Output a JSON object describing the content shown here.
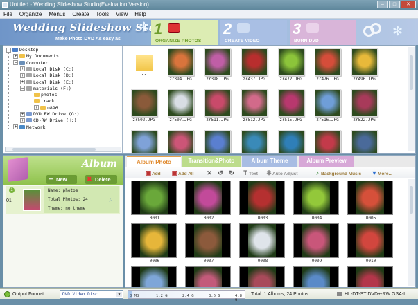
{
  "window": {
    "title": "Untitled - Wedding Slideshow Studio(Evaluation Version)"
  },
  "menu": [
    "File",
    "Organize",
    "Menus",
    "Create",
    "Tools",
    "View",
    "Help"
  ],
  "banner": {
    "logo": "Wedding Slideshow Studio",
    "slogan": "Make Photo DVD As easy as",
    "steps": [
      {
        "num": "1",
        "label": "ORGANIZE PHOTOS"
      },
      {
        "num": "2",
        "label": "CREATE VIDEO"
      },
      {
        "num": "3",
        "label": "BURN DVD"
      }
    ]
  },
  "tree": {
    "items": [
      {
        "label": "Desktop",
        "icon": "desktop-icon",
        "pm": "−"
      },
      {
        "label": "My Documents",
        "icon": "folder-icon",
        "pm": "+"
      },
      {
        "label": "Computer",
        "icon": "computer-icon",
        "pm": "−"
      },
      {
        "label": "Local Disk (C:)",
        "icon": "drive-icon",
        "pm": "+"
      },
      {
        "label": "Local Disk (D:)",
        "icon": "drive-icon",
        "pm": "+"
      },
      {
        "label": "Local Disk (E:)",
        "icon": "drive-icon",
        "pm": "+"
      },
      {
        "label": "materials (F:)",
        "icon": "drive-icon",
        "pm": "−"
      },
      {
        "label": "photos",
        "icon": "folder-icon",
        "pm": ""
      },
      {
        "label": "track",
        "icon": "folder-icon",
        "pm": ""
      },
      {
        "label": "u896",
        "icon": "folder-icon",
        "pm": "+"
      },
      {
        "label": "DVD RW Drive (G:)",
        "icon": "dvd-icon",
        "pm": "+"
      },
      {
        "label": "CD-RW Drive (H:)",
        "icon": "cd-icon",
        "pm": "+"
      },
      {
        "label": "Network",
        "icon": "network-icon",
        "pm": "+"
      }
    ]
  },
  "browser": {
    "files": [
      {
        "name": "..",
        "color": "#f2c64a",
        "folder": true
      },
      {
        "name": "zr394.JPG",
        "color": "#d9743c"
      },
      {
        "name": "zr398.JPG",
        "color": "#c05ea6"
      },
      {
        "name": "zr437.JPG",
        "color": "#b82e2e"
      },
      {
        "name": "zr472.JPG",
        "color": "#8cc43a"
      },
      {
        "name": "zr476.JPG",
        "color": "#d54d3a"
      },
      {
        "name": "zr496.JPG",
        "color": "#e8b93a"
      },
      {
        "name": "zr502.JPG",
        "color": "#8a5a3a"
      },
      {
        "name": "zr507.JPG",
        "color": "#d8dde4"
      },
      {
        "name": "zr511.JPG",
        "color": "#c94a6a"
      },
      {
        "name": "zr512.JPG",
        "color": "#d26a8a"
      },
      {
        "name": "zr515.JPG",
        "color": "#b8386e"
      },
      {
        "name": "zr516.JPG",
        "color": "#6f9ed8"
      },
      {
        "name": "zr522.JPG",
        "color": "#a83a5a"
      },
      {
        "name": "",
        "color": "#7fa2d8"
      },
      {
        "name": "",
        "color": "#cc5577"
      },
      {
        "name": "",
        "color": "#5a7fd0"
      },
      {
        "name": "",
        "color": "#3a8ab8"
      },
      {
        "name": "",
        "color": "#2f7fb8"
      },
      {
        "name": "",
        "color": "#c33a4a"
      },
      {
        "name": "",
        "color": "#4a6a9a"
      }
    ]
  },
  "album": {
    "title": "Album",
    "new_label": "New",
    "delete_label": "Delete",
    "row": {
      "index": "1",
      "number": "01",
      "name": "Name: photos",
      "total": "Total Photos: 24",
      "theme": "Theme: no theme"
    }
  },
  "tabs": [
    "Album Photo",
    "Transition&Photo",
    "Album Theme",
    "Album Preview"
  ],
  "toolbar": {
    "add": "Add",
    "add_all": "Add All",
    "text": "Text",
    "auto_adjust": "Auto Adjust",
    "music": "Background Music",
    "more": "More..."
  },
  "grid": [
    {
      "name": "0001",
      "color": "#6aa83a"
    },
    {
      "name": "0002",
      "color": "#c24a9a"
    },
    {
      "name": "0003",
      "color": "#b53030"
    },
    {
      "name": "0004",
      "color": "#93c83a"
    },
    {
      "name": "0005",
      "color": "#d6503a"
    },
    {
      "name": "0006",
      "color": "#e6b63a"
    },
    {
      "name": "0007",
      "color": "#8c5a3c"
    },
    {
      "name": "0008",
      "color": "#dfe4ea"
    },
    {
      "name": "0009",
      "color": "#c9567a"
    },
    {
      "name": "0010",
      "color": "#d2463e"
    },
    {
      "name": "",
      "color": "#7ea6d8"
    },
    {
      "name": "",
      "color": "#c35a7a"
    },
    {
      "name": "",
      "color": "#a84a5a"
    },
    {
      "name": "",
      "color": "#5a8ac8"
    },
    {
      "name": "",
      "color": "#b3364a"
    }
  ],
  "status": {
    "output_label": "Output Format:",
    "output_value": "DVD Video Disc",
    "capacity_ticks": [
      "0 MB",
      "1.2 G",
      "2.4 G",
      "3.6 G",
      "4.8 G"
    ],
    "capacity_fill_percent": 3,
    "total": "Total: 1 Albums, 24 Photos",
    "drive": "HL-DT-ST DVD+-RW GSA-I"
  },
  "colors": {
    "accent": "#e08a2e",
    "green": "#8fc24c",
    "banner": "#7ea2d4"
  }
}
